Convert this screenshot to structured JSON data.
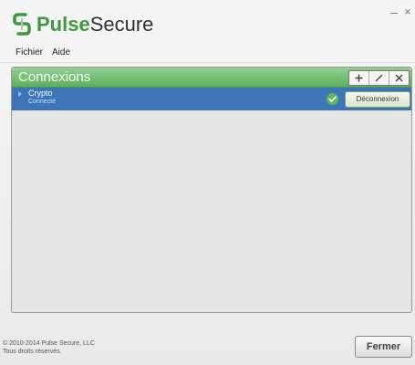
{
  "app": {
    "logo_pulse": "Pulse",
    "logo_secure": "Secure",
    "minimize_glyph": "–",
    "close_glyph": "×"
  },
  "menu": {
    "items": [
      {
        "label": "Fichier"
      },
      {
        "label": "Aide"
      }
    ]
  },
  "panel": {
    "title": "Connexions",
    "toolbar": {
      "add_icon": "plus-icon",
      "edit_icon": "pencil-icon",
      "delete_icon": "x-icon"
    },
    "connections": [
      {
        "name": "Crypto",
        "status": "Connecté",
        "status_icon": "check-circle-icon",
        "action_label": "Déconnexion"
      }
    ]
  },
  "footer": {
    "copyright": "© 2010-2014 Pulse Secure, LLC",
    "rights": "Tous droits réservés.",
    "close_label": "Fermer"
  },
  "colors": {
    "brand_green": "#3c9a3c",
    "header_green": "#5cb05c",
    "selection_blue": "#3d75b8"
  }
}
